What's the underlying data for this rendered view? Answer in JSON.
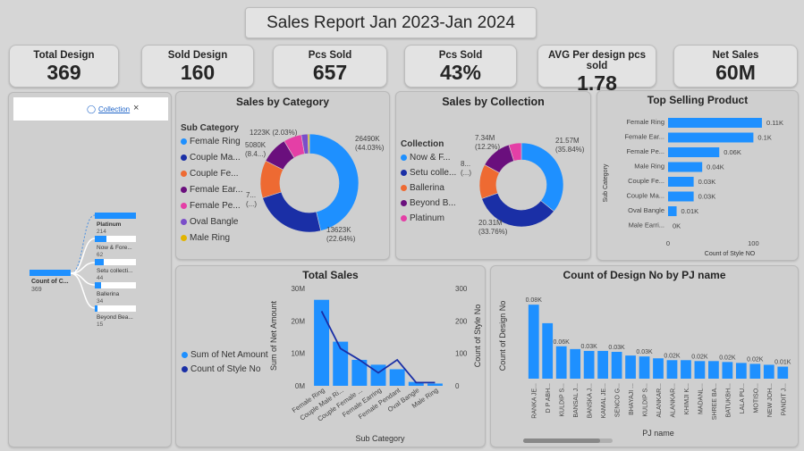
{
  "report_title": "Sales Report Jan 2023-Jan 2024",
  "kpis": [
    {
      "label": "Total Design",
      "value": "369"
    },
    {
      "label": "Sold Design",
      "value": "160"
    },
    {
      "label": "Pcs Sold",
      "value": "657"
    },
    {
      "label": "Pcs Sold",
      "value": "43%"
    },
    {
      "label": "AVG Per design pcs sold",
      "value": "1.78"
    },
    {
      "label": "Net Sales",
      "value": "60M"
    }
  ],
  "decomp": {
    "filter_label": "Collection",
    "root_label": "Count of C...",
    "root_value": "369",
    "nodes": [
      {
        "label": "Platinum",
        "value": "214",
        "fill": 1.0
      },
      {
        "label": "Now & Fore...",
        "value": "62",
        "fill": 0.29
      },
      {
        "label": "Setu collecti...",
        "value": "44",
        "fill": 0.21
      },
      {
        "label": "Ballerina",
        "value": "34",
        "fill": 0.16
      },
      {
        "label": "Beyond Bea...",
        "value": "15",
        "fill": 0.07
      }
    ]
  },
  "sales_by_category": {
    "title": "Sales by Category",
    "legend_title": "Sub Category",
    "legend": [
      {
        "label": "Female Ring",
        "color": "#1e90ff"
      },
      {
        "label": "Couple Ma...",
        "color": "#1a2fa6"
      },
      {
        "label": "Couple Fe...",
        "color": "#ee6a32"
      },
      {
        "label": "Female Ear...",
        "color": "#6a0f7d"
      },
      {
        "label": "Female Pe...",
        "color": "#e43fa6"
      },
      {
        "label": "Oval Bangle",
        "color": "#7a4ec9"
      },
      {
        "label": "Male Ring",
        "color": "#e2b400"
      }
    ],
    "labels": [
      "26490K (44.03%)",
      "13623K (22.64%)",
      "7... (...)",
      "5080K (8.4...)",
      "1223K (2.03%)"
    ]
  },
  "sales_by_collection": {
    "title": "Sales by Collection",
    "legend_title": "Collection",
    "legend": [
      {
        "label": "Now & F...",
        "color": "#1e90ff"
      },
      {
        "label": "Setu colle...",
        "color": "#1a2fa6"
      },
      {
        "label": "Ballerina",
        "color": "#ee6a32"
      },
      {
        "label": "Beyond B...",
        "color": "#6a0f7d"
      },
      {
        "label": "Platinum",
        "color": "#e43fa6"
      }
    ],
    "labels": [
      "21.57M (35.84%)",
      "20.31M (33.76%)",
      "8... (...)",
      "7.34M (12.2%)"
    ]
  },
  "top_selling": {
    "title": "Top Selling Product",
    "ylabel": "Sub Category",
    "xlabel": "Count of Style NO",
    "ticks": [
      "0",
      "100"
    ]
  },
  "total_sales": {
    "title": "Total Sales",
    "legend": [
      {
        "label": "Sum of Net Amount",
        "color": "#1e90ff"
      },
      {
        "label": "Count of Style No",
        "color": "#1a2fa6"
      }
    ],
    "ylabel_left": "Sum of Net Amount",
    "ylabel_right": "Count of Style No",
    "xlabel": "Sub Category",
    "left_ticks": [
      "0M",
      "10M",
      "20M",
      "30M"
    ],
    "right_ticks": [
      "0",
      "100",
      "200",
      "300"
    ]
  },
  "pj_chart": {
    "title": "Count of Design No by PJ name",
    "ylabel": "Count of Design No",
    "xlabel": "PJ name"
  },
  "chart_data": [
    {
      "type": "pie",
      "title": "Sales by Category",
      "categories": [
        "Female Ring",
        "Couple Male Ring",
        "Couple Female Ring",
        "Female Earring",
        "Female Pendant",
        "Oval Bangle",
        "Male Ring"
      ],
      "values": [
        26490,
        13623,
        7100,
        5080,
        3400,
        1223,
        300
      ],
      "unit": "K"
    },
    {
      "type": "pie",
      "title": "Sales by Collection",
      "categories": [
        "Now & Forever",
        "Setu collection",
        "Ballerina",
        "Beyond Beauty",
        "Platinum"
      ],
      "values": [
        21.57,
        20.31,
        8.0,
        7.34,
        2.9
      ],
      "unit": "M"
    },
    {
      "type": "bar",
      "title": "Top Selling Product",
      "categories": [
        "Female Ring",
        "Female Ear...",
        "Female Pe...",
        "Male Ring",
        "Couple Fe...",
        "Couple Ma...",
        "Oval Bangle",
        "Male Earri..."
      ],
      "values": [
        110,
        100,
        60,
        40,
        30,
        30,
        10,
        0
      ],
      "labels": [
        "0.11K",
        "0.1K",
        "0.06K",
        "0.04K",
        "0.03K",
        "0.03K",
        "0.01K",
        "0K"
      ],
      "xlim": [
        0,
        130
      ]
    },
    {
      "type": "bar",
      "title": "Total Sales",
      "categories": [
        "Female Ring",
        "Couple Male Ri...",
        "Couple Female ...",
        "Female Earring",
        "Female Pendant",
        "Oval Bangle",
        "Male Ring"
      ],
      "series": [
        {
          "name": "Sum of Net Amount",
          "values": [
            26.5,
            13.6,
            8.0,
            6.5,
            5.1,
            1.2,
            0.7
          ]
        },
        {
          "name": "Count of Style No",
          "values": [
            230,
            115,
            80,
            40,
            80,
            10,
            10
          ]
        }
      ],
      "ylim": [
        0,
        30
      ],
      "y2lim": [
        0,
        300
      ]
    },
    {
      "type": "bar",
      "title": "Count of Design No by PJ name",
      "categories": [
        "RANKA JE...",
        "D P ABH...",
        "KULDIP S...",
        "BANSAL J...",
        "BANSKA J...",
        "KAMAL JE...",
        "SENCO G...",
        "BHAYAJI ...",
        "KULDIP S...",
        "ALANKAR...",
        "ALANKAR...",
        "KHIMJI K...",
        "MADANL...",
        "SHREE BA...",
        "BATUKBH...",
        "LALA PU...",
        "MOTISO...",
        "NEW JOH...",
        "PANDIT J..."
      ],
      "values": [
        80,
        60,
        35,
        32,
        30,
        30,
        29,
        25,
        24,
        22,
        20,
        20,
        19,
        19,
        18,
        17,
        16,
        15,
        13
      ],
      "labels": [
        "0.08K",
        "0.06K",
        "0.03K",
        "0.03K",
        "0.03K",
        "0.02K",
        "0.02K",
        "0.02K",
        "0.02K",
        "0.01K",
        "0.01K"
      ]
    }
  ]
}
